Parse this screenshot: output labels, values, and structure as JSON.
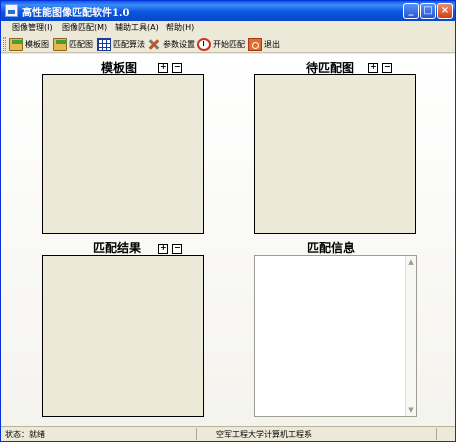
{
  "window": {
    "title": "高性能图像匹配软件1.0",
    "minimize_glyph": "_",
    "maximize_glyph": "□",
    "close_glyph": "×"
  },
  "menu": {
    "items": [
      {
        "label": "图像管理(I)"
      },
      {
        "label": "图像匹配(M)"
      },
      {
        "label": "辅助工具(A)"
      },
      {
        "label": "帮助(H)"
      }
    ]
  },
  "toolbar": {
    "items": [
      {
        "label": "模板图",
        "icon": "open-folder-icon"
      },
      {
        "label": "匹配图",
        "icon": "open-folder-icon"
      },
      {
        "label": "匹配算法",
        "icon": "grid-icon"
      },
      {
        "label": "参数设置",
        "icon": "tools-icon"
      },
      {
        "label": "开始匹配",
        "icon": "clock-icon"
      },
      {
        "label": "退出",
        "icon": "exit-icon"
      }
    ]
  },
  "panels": {
    "template": {
      "title": "模板图"
    },
    "target": {
      "title": "待匹配图"
    },
    "result": {
      "title": "匹配结果"
    },
    "info": {
      "title": "匹配信息",
      "content": ""
    }
  },
  "statusbar": {
    "status": "状态：就绪",
    "organization": "空军工程大学计算机工程系"
  },
  "colors": {
    "titlebar": "#0a55e0",
    "image_background": "#ece9d8",
    "info_background": "#ffffff"
  }
}
